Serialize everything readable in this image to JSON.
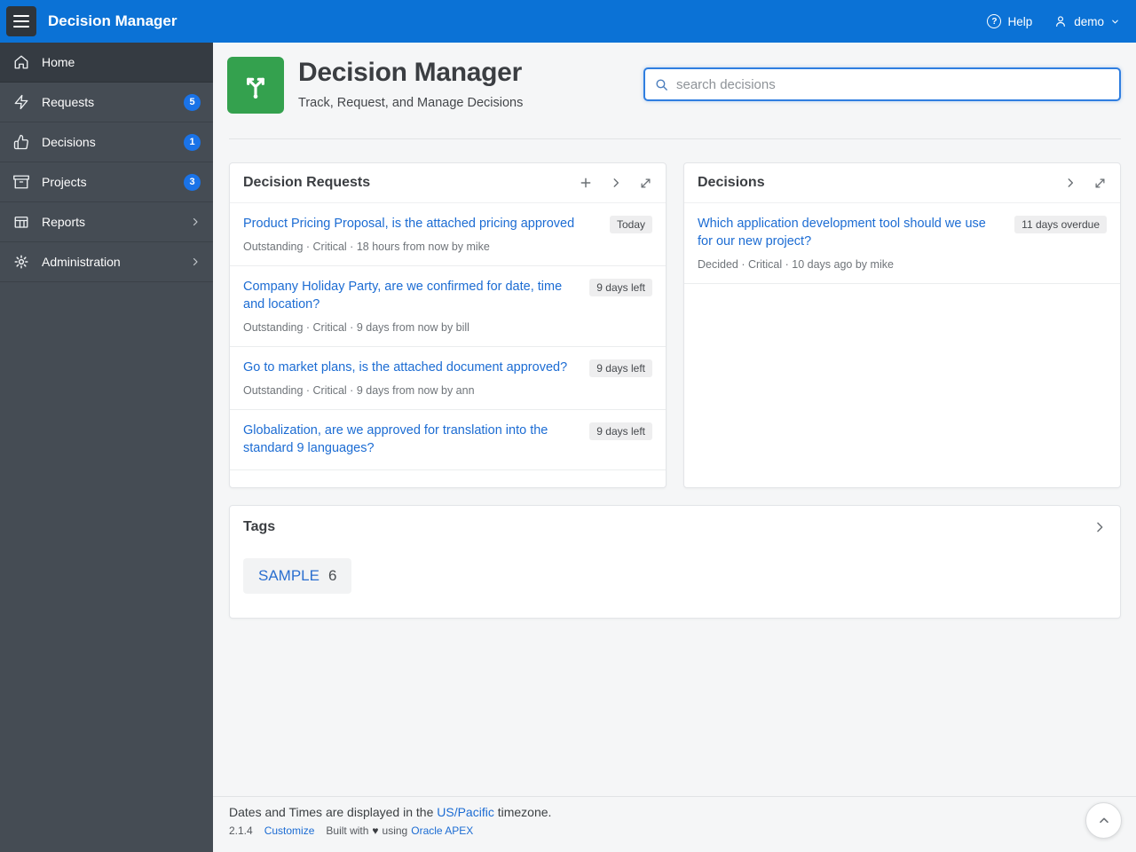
{
  "app": {
    "title": "Decision Manager"
  },
  "header": {
    "help": "Help",
    "user": "demo"
  },
  "sidebar": {
    "items": [
      {
        "label": "Home"
      },
      {
        "label": "Requests",
        "badge": "5"
      },
      {
        "label": "Decisions",
        "badge": "1"
      },
      {
        "label": "Projects",
        "badge": "3"
      },
      {
        "label": "Reports"
      },
      {
        "label": "Administration"
      }
    ]
  },
  "page": {
    "title": "Decision Manager",
    "subtitle": "Track, Request, and Manage Decisions",
    "search_placeholder": "search decisions"
  },
  "requests_card": {
    "title": "Decision Requests",
    "items": [
      {
        "title": "Product Pricing Proposal, is the attached pricing approved",
        "badge": "Today",
        "meta": "Outstanding · Critical · 18 hours from now by mike"
      },
      {
        "title": "Company Holiday Party, are we confirmed for date, time and location?",
        "badge": "9 days left",
        "meta": "Outstanding · Critical · 9 days from now by bill"
      },
      {
        "title": "Go to market plans, is the attached document approved?",
        "badge": "9 days left",
        "meta": "Outstanding · Critical · 9 days from now by ann"
      },
      {
        "title": "Globalization, are we approved for translation into the standard 9 languages?",
        "badge": "9 days left"
      }
    ]
  },
  "decisions_card": {
    "title": "Decisions",
    "items": [
      {
        "title": "Which application development tool should we use for our new project?",
        "badge": "11 days overdue",
        "meta": "Decided · Critical · 10 days ago by mike"
      }
    ]
  },
  "tags_card": {
    "title": "Tags",
    "tags": [
      {
        "label": "SAMPLE",
        "count": "6"
      }
    ]
  },
  "footer": {
    "timezone_prefix": "Dates and Times are displayed in the",
    "timezone_link": "US/Pacific",
    "timezone_suffix": "timezone.",
    "version": "2.1.4",
    "customize": "Customize",
    "built_prefix": "Built with",
    "heart": "♥",
    "built_mid": "using",
    "apex_link": "Oracle APEX"
  },
  "colors": {
    "header_blue": "#0b72d6",
    "sidebar_dark": "#454c54",
    "link_blue": "#1c6cd3",
    "app_icon_green": "#34a14e",
    "badge_blue": "#1a73e8",
    "badge_gray_bg": "#eeeeef"
  }
}
